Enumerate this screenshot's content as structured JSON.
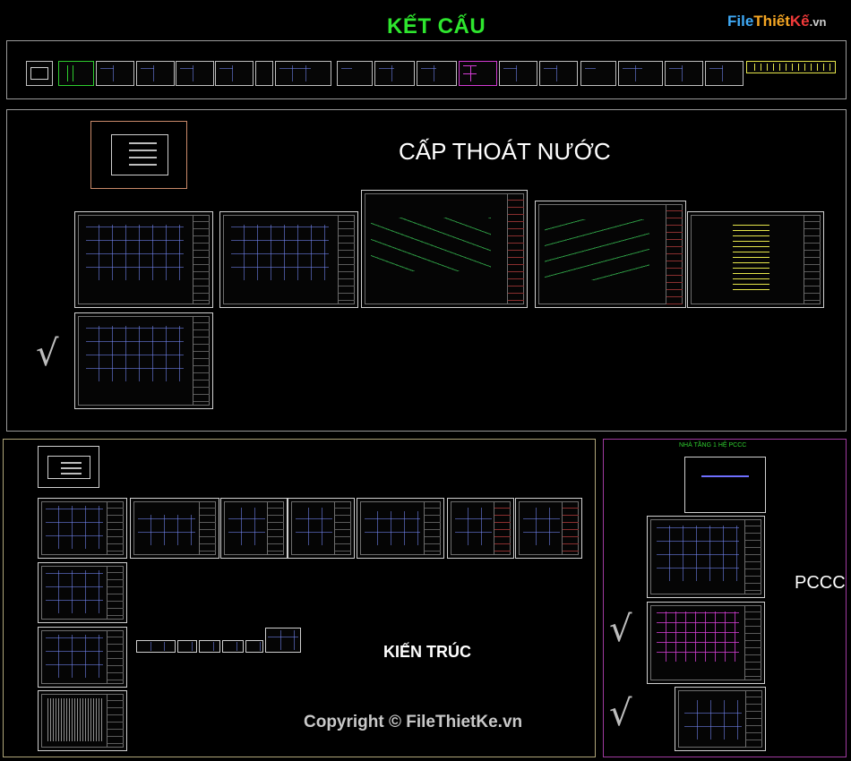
{
  "sections": {
    "ket_cau": "KẾT CẤU",
    "cap_thoat_nuoc": "CẤP THOÁT NƯỚC",
    "kien_truc": "KIẾN TRÚC",
    "pccc": "PCCC",
    "pccc_header": "NHÀ TẦNG 1 HỆ PCCC"
  },
  "logo": {
    "file": "File",
    "thiet": "Thiết",
    "ke": "Kế",
    "vn": ".vn"
  },
  "watermark": "Copyright © FileThietKe.vn",
  "marks": {
    "check": "√"
  },
  "colors": {
    "accent_green": "#2ee62e",
    "frame": "#9a9a9a",
    "pccc_frame": "#a03aa0"
  }
}
